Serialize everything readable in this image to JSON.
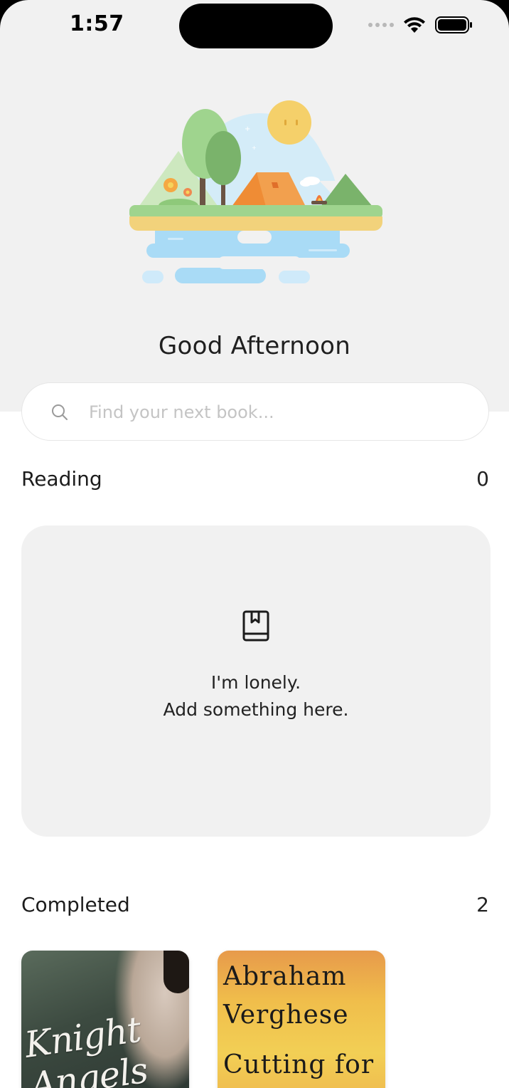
{
  "status_bar": {
    "time": "1:57"
  },
  "header": {
    "greeting": "Good Afternoon",
    "illustration": "camping-scene"
  },
  "search": {
    "placeholder": "Find your next book...",
    "value": ""
  },
  "reading": {
    "title": "Reading",
    "count": "0",
    "empty_line1": "I'm lonely.",
    "empty_line2": "Add something here."
  },
  "completed": {
    "title": "Completed",
    "count": "2",
    "books": [
      {
        "cover_title": "Knight Angels"
      },
      {
        "cover_author_line1": "Abraham",
        "cover_author_line2": "Verghese",
        "cover_title": "Cutting for"
      }
    ]
  },
  "colors": {
    "hero_bg": "#f1f1f1",
    "card_bg": "#f1f1f1",
    "text": "#1c1c1c",
    "placeholder": "#c4c4c4"
  }
}
